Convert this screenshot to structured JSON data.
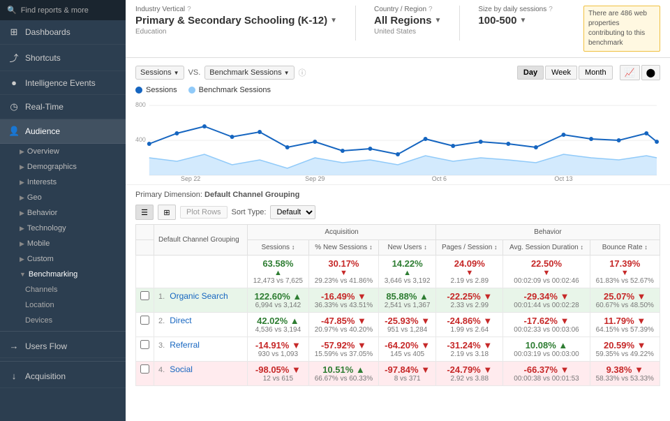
{
  "sidebar": {
    "search_placeholder": "Find reports & more",
    "nav_items": [
      {
        "id": "dashboards",
        "label": "Dashboards",
        "icon": "⊞"
      },
      {
        "id": "shortcuts",
        "label": "Shortcuts",
        "icon": "⤴"
      },
      {
        "id": "intelligence",
        "label": "Intelligence Events",
        "icon": "●"
      },
      {
        "id": "realtime",
        "label": "Real-Time",
        "icon": "◷"
      },
      {
        "id": "audience",
        "label": "Audience",
        "icon": "👤",
        "active": true
      },
      {
        "id": "acquisition",
        "label": "Acquisition",
        "icon": "↓"
      }
    ],
    "audience_sub": [
      {
        "id": "overview",
        "label": "Overview"
      },
      {
        "id": "demographics",
        "label": "Demographics"
      },
      {
        "id": "interests",
        "label": "Interests"
      },
      {
        "id": "geo",
        "label": "Geo"
      },
      {
        "id": "behavior",
        "label": "Behavior"
      },
      {
        "id": "technology",
        "label": "Technology"
      },
      {
        "id": "mobile",
        "label": "Mobile"
      },
      {
        "id": "custom",
        "label": "Custom"
      },
      {
        "id": "benchmarking",
        "label": "Benchmarking",
        "expanded": true
      }
    ],
    "benchmarking_sub": [
      {
        "id": "channels",
        "label": "Channels",
        "active": true
      },
      {
        "id": "location",
        "label": "Location"
      },
      {
        "id": "devices",
        "label": "Devices"
      }
    ],
    "users_flow": "Users Flow"
  },
  "topbar": {
    "industry_label": "Industry Vertical",
    "industry_value": "Primary & Secondary Schooling (K-12)",
    "industry_sub": "Education",
    "country_label": "Country / Region",
    "country_value": "All Regions",
    "country_sub": "United States",
    "size_label": "Size by daily sessions",
    "size_value": "100-500",
    "benchmark_note": "There are 486 web properties contributing to this benchmark"
  },
  "chart": {
    "metric1": "Sessions",
    "metric2": "Benchmark Sessions",
    "y_label_top": "800",
    "y_label_mid": "400",
    "dates": [
      "Sep 22",
      "Sep 29",
      "Oct 6",
      "Oct 13"
    ],
    "time_buttons": [
      "Day",
      "Week",
      "Month"
    ],
    "active_time": "Day"
  },
  "table": {
    "primary_dim_label": "Primary Dimension:",
    "primary_dim_value": "Default Channel Grouping",
    "sort_label": "Sort Type:",
    "sort_value": "Default",
    "plot_rows": "Plot Rows",
    "col_groups": [
      "Acquisition",
      "Behavior"
    ],
    "headers": {
      "channel": "Default Channel Grouping",
      "sessions": "Sessions",
      "pct_new": "% New Sessions",
      "new_users": "New Users",
      "pages_session": "Pages / Session",
      "avg_duration": "Avg. Session Duration",
      "bounce_rate": "Bounce Rate"
    },
    "total_row": {
      "sessions": "63.58%",
      "sessions_sub": "12,473 vs 7,625",
      "sessions_dir": "up",
      "pct_new": "30.17%",
      "pct_new_sub": "29.23% vs 41.86%",
      "pct_new_dir": "down",
      "new_users": "14.22%",
      "new_users_sub": "3,646 vs 3,192",
      "new_users_dir": "up",
      "pages": "24.09%",
      "pages_sub": "2.19 vs 2.89",
      "pages_dir": "down",
      "duration": "22.50%",
      "duration_sub": "00:02:09 vs 00:02:46",
      "duration_dir": "down",
      "bounce": "17.39%",
      "bounce_sub": "61.83% vs 52.67%",
      "bounce_dir": "down"
    },
    "rows": [
      {
        "num": "1.",
        "name": "Organic Search",
        "bg": "green",
        "sessions": "122.60%",
        "sessions_sub": "6,994 vs 3,142",
        "sessions_dir": "up",
        "pct_new": "-16.49%",
        "pct_new_sub": "36.33% vs 43.51%",
        "pct_new_dir": "down",
        "new_users": "85.88%",
        "new_users_sub": "2,541 vs 1,367",
        "new_users_dir": "up",
        "pages": "-22.25%",
        "pages_sub": "2.33 vs 2.99",
        "pages_dir": "down",
        "duration": "-29.34%",
        "duration_sub": "00:01:44 vs 00:02:28",
        "duration_dir": "down",
        "bounce": "25.07%",
        "bounce_sub": "60.67% vs 48.50%",
        "bounce_dir": "down"
      },
      {
        "num": "2.",
        "name": "Direct",
        "bg": "neutral",
        "sessions": "42.02%",
        "sessions_sub": "4,536 vs 3,194",
        "sessions_dir": "up",
        "pct_new": "-47.85%",
        "pct_new_sub": "20.97% vs 40.20%",
        "pct_new_dir": "down",
        "new_users": "-25.93%",
        "new_users_sub": "951 vs 1,284",
        "new_users_dir": "down",
        "pages": "-24.86%",
        "pages_sub": "1.99 vs 2.64",
        "pages_dir": "down",
        "duration": "-17.62%",
        "duration_sub": "00:02:33 vs 00:03:06",
        "duration_dir": "down",
        "bounce": "11.79%",
        "bounce_sub": "64.15% vs 57.39%",
        "bounce_dir": "down"
      },
      {
        "num": "3.",
        "name": "Referral",
        "bg": "neutral",
        "sessions": "-14.91%",
        "sessions_sub": "930 vs 1,093",
        "sessions_dir": "down",
        "pct_new": "-57.92%",
        "pct_new_sub": "15.59% vs 37.05%",
        "pct_new_dir": "down",
        "new_users": "-64.20%",
        "new_users_sub": "145 vs 405",
        "new_users_dir": "down",
        "pages": "-31.24%",
        "pages_sub": "2.19 vs 3.18",
        "pages_dir": "down",
        "duration": "10.08%",
        "duration_sub": "00:03:19 vs 00:03:00",
        "duration_dir": "up",
        "bounce": "20.59%",
        "bounce_sub": "59.35% vs 49.22%",
        "bounce_dir": "down"
      },
      {
        "num": "4.",
        "name": "Social",
        "bg": "red",
        "sessions": "-98.05%",
        "sessions_sub": "12 vs 615",
        "sessions_dir": "down",
        "pct_new": "10.51%",
        "pct_new_sub": "66.67% vs 60.33%",
        "pct_new_dir": "up",
        "new_users": "-97.84%",
        "new_users_sub": "8 vs 371",
        "new_users_dir": "down",
        "pages": "-24.79%",
        "pages_sub": "2.92 vs 3.88",
        "pages_dir": "down",
        "duration": "-66.37%",
        "duration_sub": "00:00:38 vs 00:01:53",
        "duration_dir": "down",
        "bounce": "9.38%",
        "bounce_sub": "58.33% vs 53.33%",
        "bounce_dir": "down"
      }
    ]
  },
  "colors": {
    "sessions_line": "#1565c0",
    "benchmark_line": "#90caf9",
    "green": "#2e7d32",
    "red": "#c62828",
    "accent": "#f0c040"
  }
}
